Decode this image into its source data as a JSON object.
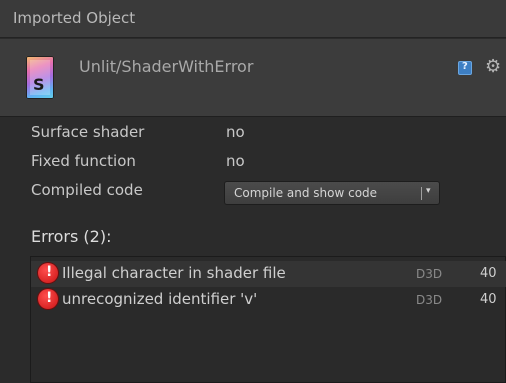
{
  "window": {
    "title": "Imported Object"
  },
  "asset": {
    "name": "Unlit/ShaderWithError",
    "icon": "shader-file-icon",
    "icon_letter": "S"
  },
  "header_icons": {
    "help": "help-book-icon",
    "help_glyph": "?",
    "settings": "gear-icon",
    "settings_glyph": "⚙"
  },
  "properties": [
    {
      "label": "Surface shader",
      "value": "no"
    },
    {
      "label": "Fixed function",
      "value": "no"
    },
    {
      "label": "Compiled code",
      "value": ""
    }
  ],
  "compile_dropdown": {
    "label": "Compile and show code",
    "arrow": "▾"
  },
  "errors": {
    "title": "Errors (2):",
    "items": [
      {
        "message": "Illegal character in shader file",
        "platform": "D3D",
        "line": "40",
        "icon_glyph": "!"
      },
      {
        "message": "unrecognized identifier 'v'",
        "platform": "D3D",
        "line": "40",
        "icon_glyph": "!"
      }
    ]
  },
  "colors": {
    "panel": "#2b2b2b",
    "header": "#3c3c3c",
    "error_red": "#d91c1c",
    "text": "#c8c8c8"
  }
}
